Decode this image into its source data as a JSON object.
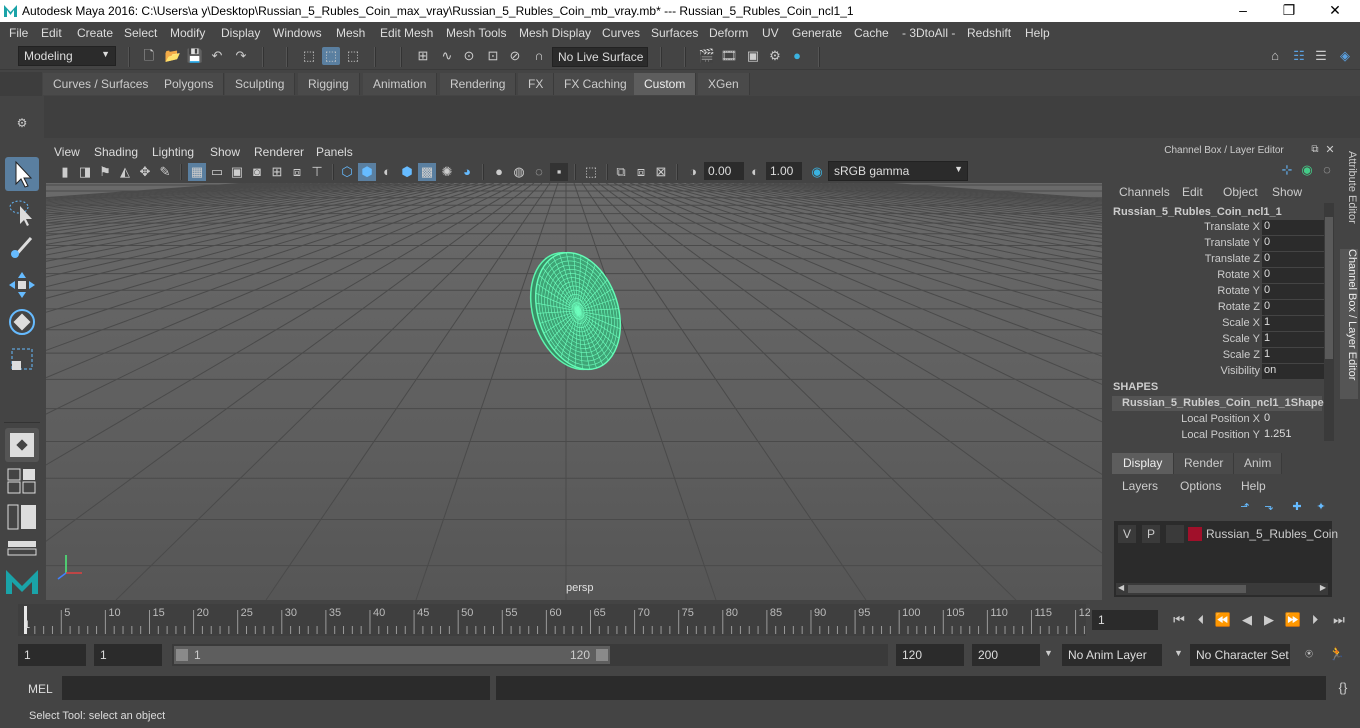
{
  "title": {
    "text": "Autodesk Maya 2016: C:\\Users\\a y\\Desktop\\Russian_5_Rubles_Coin_max_vray\\Russian_5_Rubles_Coin_mb_vray.mb*   ---   Russian_5_Rubles_Coin_ncl1_1",
    "minimize": "–",
    "maximize": "❐",
    "close": "✕"
  },
  "menu": [
    "File",
    "Edit",
    "Create",
    "Select",
    "Modify",
    "Display",
    "Windows",
    "Mesh",
    "Edit Mesh",
    "Mesh Tools",
    "Mesh Display",
    "Curves",
    "Surfaces",
    "Deform",
    "UV",
    "Generate",
    "Cache",
    "- 3DtoAll -",
    "Redshift",
    "Help"
  ],
  "status": {
    "mode": "Modeling",
    "live_surface": "No Live Surface"
  },
  "shelf_tabs": [
    "Curves / Surfaces",
    "Polygons",
    "Sculpting",
    "Rigging",
    "Animation",
    "Rendering",
    "FX",
    "FX Caching",
    "Custom",
    "XGen"
  ],
  "shelf_active": "Custom",
  "viewport": {
    "menu": [
      "View",
      "Shading",
      "Lighting",
      "Show",
      "Renderer",
      "Panels"
    ],
    "exposure": "0.00",
    "gamma": "1.00",
    "color_space": "sRGB gamma",
    "camera": "persp"
  },
  "channel_box": {
    "header": "Channel Box / Layer Editor",
    "menu": [
      "Channels",
      "Edit",
      "Object",
      "Show"
    ],
    "object_name": "Russian_5_Rubles_Coin_ncl1_1",
    "attributes": [
      {
        "label": "Translate X",
        "value": "0"
      },
      {
        "label": "Translate Y",
        "value": "0"
      },
      {
        "label": "Translate Z",
        "value": "0"
      },
      {
        "label": "Rotate X",
        "value": "0"
      },
      {
        "label": "Rotate Y",
        "value": "0"
      },
      {
        "label": "Rotate Z",
        "value": "0"
      },
      {
        "label": "Scale X",
        "value": "1"
      },
      {
        "label": "Scale Y",
        "value": "1"
      },
      {
        "label": "Scale Z",
        "value": "1"
      },
      {
        "label": "Visibility",
        "value": "on"
      }
    ],
    "shapes_title": "SHAPES",
    "shape_name": "Russian_5_Rubles_Coin_ncl1_1Shape",
    "shape_attrs": [
      {
        "label": "Local Position X",
        "value": "0"
      },
      {
        "label": "Local Position Y",
        "value": "1.251"
      }
    ]
  },
  "layer_editor": {
    "tabs": [
      "Display",
      "Render",
      "Anim"
    ],
    "active_tab": "Display",
    "menu": [
      "Layers",
      "Options",
      "Help"
    ],
    "layer": {
      "v": "V",
      "p": "P",
      "name": "Russian_5_Rubles_Coin",
      "color": "#a0102a"
    }
  },
  "side_tabs": [
    "Attribute Editor",
    "Channel Box / Layer Editor"
  ],
  "timeline": {
    "ticks": [
      "5",
      "10",
      "15",
      "20",
      "25",
      "30",
      "35",
      "40",
      "45",
      "50",
      "55",
      "60",
      "65",
      "70",
      "75",
      "80",
      "85",
      "90",
      "95",
      "100",
      "105",
      "110",
      "115",
      "12"
    ],
    "current_frame_label": "1",
    "current_frame": "1"
  },
  "range": {
    "start": "1",
    "start_inner": "1",
    "slider_start": "1",
    "slider_end": "120",
    "end_inner": "120",
    "end": "200",
    "anim_layer": "No Anim Layer",
    "character_set": "No Character Set"
  },
  "cmd": {
    "label": "MEL"
  },
  "help_text": "Select Tool: select an object",
  "colors": {
    "wire": "#4ef0a0",
    "accent": "#5aa0e0",
    "layer": "#a0102a"
  }
}
